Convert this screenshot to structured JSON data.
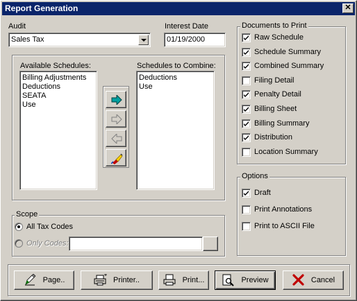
{
  "window": {
    "title": "Report Generation"
  },
  "audit": {
    "label": "Audit",
    "value": "Sales Tax"
  },
  "interest_date": {
    "label": "Interest Date",
    "value": "01/19/2000"
  },
  "schedules": {
    "available_label": "Available Schedules:",
    "available": [
      "Billing Adjustments",
      "Deductions",
      "SEATA",
      "Use"
    ],
    "combine_label": "Schedules to Combine:",
    "combine": [
      "Deductions",
      "Use"
    ]
  },
  "scope": {
    "label": "Scope",
    "all_tax_codes": "All Tax Codes",
    "only_codes": "Only Codes:",
    "only_codes_value": ""
  },
  "documents": {
    "label": "Documents to Print",
    "items": [
      {
        "label": "Raw Schedule",
        "checked": true
      },
      {
        "label": "Schedule Summary",
        "checked": true
      },
      {
        "label": "Combined Summary",
        "checked": true
      },
      {
        "label": "Filing Detail",
        "checked": false
      },
      {
        "label": "Penalty Detail",
        "checked": true
      },
      {
        "label": "Billing Sheet",
        "checked": true
      },
      {
        "label": "Billing Summary",
        "checked": true
      },
      {
        "label": "Distribution",
        "checked": true
      },
      {
        "label": "Location Summary",
        "checked": false
      }
    ]
  },
  "options": {
    "label": "Options",
    "items": [
      {
        "label": "Draft",
        "checked": true
      },
      {
        "label": "Print Annotations",
        "checked": false
      },
      {
        "label": "Print to ASCII File",
        "checked": false
      }
    ]
  },
  "buttons": {
    "page": "Page..",
    "printer": "Printer..",
    "print": "Print...",
    "preview": "Preview",
    "cancel": "Cancel"
  },
  "colors": {
    "titlebar": "#0a246a",
    "face": "#d4d0c8",
    "arrow_active": "#008080",
    "cancel_x": "#c00000"
  }
}
